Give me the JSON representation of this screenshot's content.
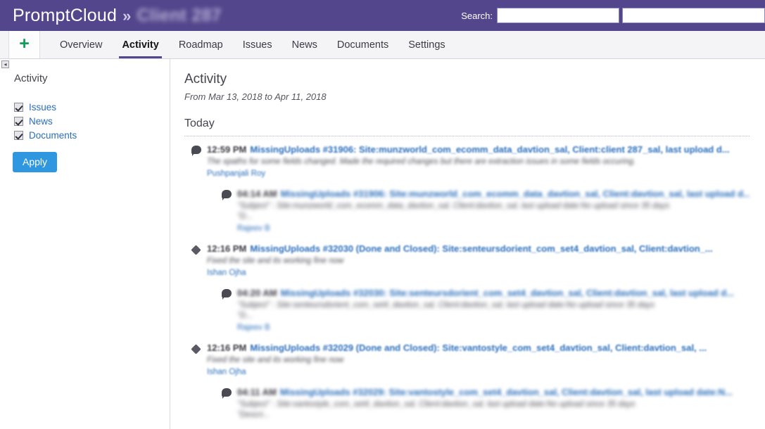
{
  "header": {
    "app_name": "PromptCloud",
    "separator": "»",
    "client_name": "Client 287",
    "search_label": "Search:",
    "search_value_1": "",
    "search_value_2": "",
    "bar_color": "#54468c"
  },
  "tabs": {
    "new_object_icon": "plus-icon",
    "items": [
      {
        "label": "Overview",
        "active": false
      },
      {
        "label": "Activity",
        "active": true
      },
      {
        "label": "Roadmap",
        "active": false
      },
      {
        "label": "Issues",
        "active": false
      },
      {
        "label": "News",
        "active": false
      },
      {
        "label": "Documents",
        "active": false
      },
      {
        "label": "Settings",
        "active": false
      }
    ]
  },
  "sidebar": {
    "collapse_icon": "collapse-left-icon",
    "title": "Activity",
    "filters": [
      {
        "label": "Issues",
        "checked": true
      },
      {
        "label": "News",
        "checked": true
      },
      {
        "label": "Documents",
        "checked": true
      }
    ],
    "apply_label": "Apply",
    "apply_color": "#2f96e0"
  },
  "main": {
    "title": "Activity",
    "date_range": "From Mar 13, 2018 to Apr 11, 2018",
    "day_header": "Today",
    "entries": [
      {
        "icon": "comment-icon",
        "nested": false,
        "time": "12:59 PM",
        "title": "MissingUploads #31906: Site:munzworld_com_ecomm_data_davtion_sal, Client:client 287_sal, last upload d...",
        "description": "The xpaths for some fields changed. Made the required changes but there are extraction issues in some fields occuring.",
        "description2": "",
        "author": "Pushpanjali Roy"
      },
      {
        "icon": "comment-icon",
        "nested": true,
        "time": "04:14 AM",
        "title": "MissingUploads #31906: Site:munzworld_com_ecomm_data_davtion_sal, Client:davtion_sal, last upload d...",
        "description": "\"Subject\" : Site:munzworld_com_ecomm_data_davtion_sal, Client:davtion_sal, last upload date:No upload since 35 days",
        "description2": "\"D...",
        "author": "Rajeev B"
      },
      {
        "icon": "issue-icon",
        "nested": false,
        "time": "12:16 PM",
        "title": "MissingUploads #32030 (Done and Closed): Site:senteursdorient_com_set4_davtion_sal, Client:davtion_...",
        "description": "Fixed the site and its working fine now",
        "description2": "",
        "author": "Ishan Ojha"
      },
      {
        "icon": "comment-icon",
        "nested": true,
        "time": "04:20 AM",
        "title": "MissingUploads #32030: Site:senteursdorient_com_set4_davtion_sal, Client:davtion_sal, last upload d...",
        "description": "\"Subject\" : Site:senteursdorient_com_set4_davtion_sal, Client:davtion_sal, last upload date:No upload since 35 days",
        "description2": "\"D...",
        "author": "Rajeev B"
      },
      {
        "icon": "issue-icon",
        "nested": false,
        "time": "12:16 PM",
        "title": "MissingUploads #32029 (Done and Closed): Site:vantostyle_com_set4_davtion_sal, Client:davtion_sal, ...",
        "description": "Fixed the site and its working fine now",
        "description2": "",
        "author": "Ishan Ojha"
      },
      {
        "icon": "comment-icon",
        "nested": true,
        "time": "04:11 AM",
        "title": "MissingUploads #32029: Site:vantostyle_com_set4_davtion_sal, Client:davtion_sal, last upload date:N...",
        "description": "\"Subject\" : Site:vantostyle_com_set4_davtion_sal, Client:davtion_sal, last upload date:No upload since 35 days",
        "description2": "\"Descri...",
        "author": ""
      }
    ]
  }
}
